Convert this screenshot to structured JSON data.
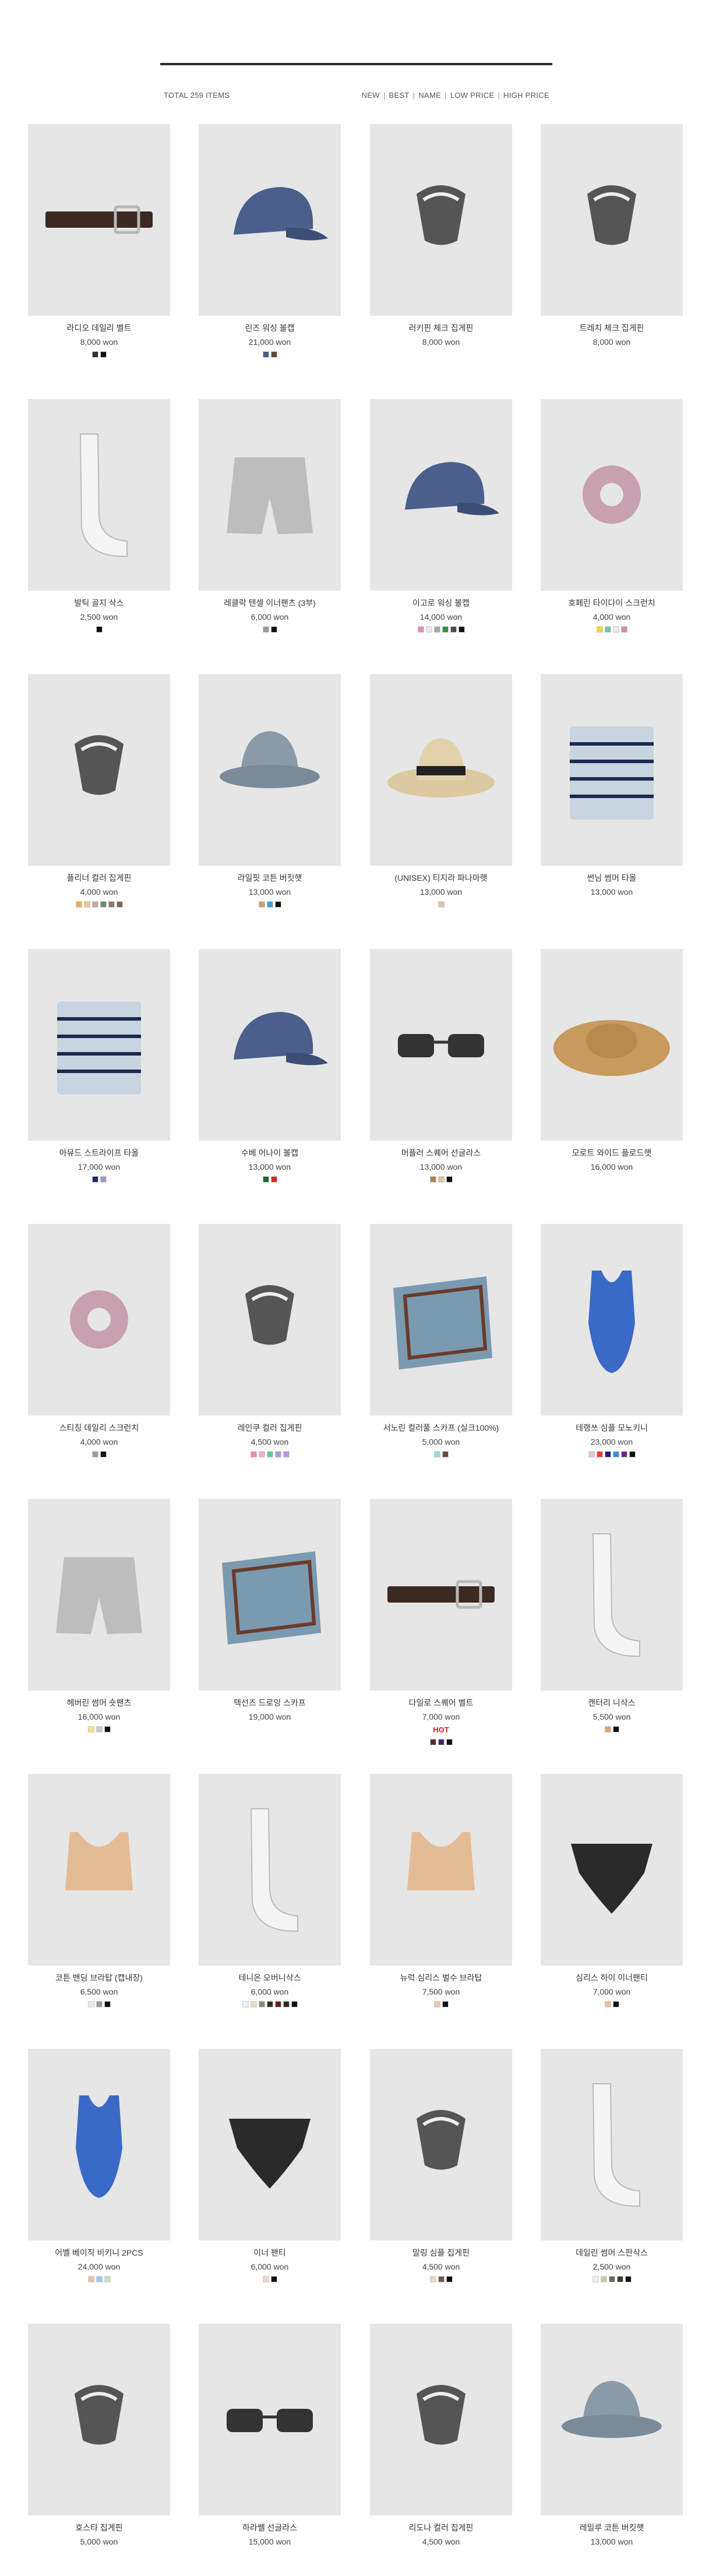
{
  "header": {
    "total_items": "TOTAL 259 ITEMS",
    "sort_options": [
      "NEW",
      "BEST",
      "NAME",
      "LOW PRICE",
      "HIGH PRICE"
    ]
  },
  "products": [
    {
      "name": "라디오 데일리 벨트",
      "price": "8,000 won",
      "colors": [
        "#3a2a20",
        "#111111"
      ],
      "icon": "belt-icon"
    },
    {
      "name": "린즈 워싱 볼캡",
      "price": "21,000 won",
      "colors": [
        "#4a5a80",
        "#5a4a38"
      ],
      "icon": "cap-icon"
    },
    {
      "name": "러키핀 체크 집게핀",
      "price": "8,000 won",
      "colors": [],
      "icon": "hair-claw-icon"
    },
    {
      "name": "트레치 체크 집게핀",
      "price": "8,000 won",
      "colors": [],
      "icon": "hair-claw-icon"
    },
    {
      "name": "발틱 골지 삭스",
      "price": "2,500 won",
      "colors": [
        "#111111"
      ],
      "icon": "socks-icon"
    },
    {
      "name": "레클락 텐셀 이너팬츠 (3부)",
      "price": "6,000 won",
      "colors": [
        "#9a9a9a",
        "#111111"
      ],
      "icon": "shorts-icon"
    },
    {
      "name": "이고로 워싱 볼캡",
      "price": "14,000 won",
      "colors": [
        "#e58ac0",
        "#e8e8e8",
        "#a8a8a8",
        "#2f8f3a",
        "#4a4a4a",
        "#111111"
      ],
      "icon": "cap-icon"
    },
    {
      "name": "호페린 타이다이 스크런치",
      "price": "4,000 won",
      "colors": [
        "#f2d63a",
        "#6cc6b0",
        "#e9e9e9",
        "#d88aa8"
      ],
      "icon": "scrunchie-icon"
    },
    {
      "name": "플리너 컬러 집게핀",
      "price": "4,000 won",
      "colors": [
        "#f0a860",
        "#e8c890",
        "#d4a0a0",
        "#6a8a6a",
        "#8a7a6a",
        "#7a6a5a"
      ],
      "icon": "hair-claw-icon"
    },
    {
      "name": "라일핏 코튼 버킷햇",
      "price": "13,000 won",
      "colors": [
        "#d4a060",
        "#3aa0e0",
        "#111111"
      ],
      "icon": "bucket-hat-icon"
    },
    {
      "name": "(UNISEX) 티지라 파나마햇",
      "price": "13,000 won",
      "colors": [
        "#d8c8a0"
      ],
      "icon": "panama-hat-icon"
    },
    {
      "name": "썬님 썸머 타올",
      "price": "13,000 won",
      "colors": [],
      "icon": "towel-icon"
    },
    {
      "name": "아뮤드 스트라이프 타올",
      "price": "17,000 won",
      "colors": [
        "#1a2a6a",
        "#9a9ac8"
      ],
      "icon": "towel-icon"
    },
    {
      "name": "수베 어나이 볼캡",
      "price": "13,000 won",
      "colors": [
        "#1a6a2a",
        "#c82a2a"
      ],
      "icon": "cap-icon"
    },
    {
      "name": "머플러 스퀘어 선글라스",
      "price": "13,000 won",
      "colors": [
        "#b08050",
        "#d8c0a0",
        "#111111"
      ],
      "icon": "sunglasses-icon"
    },
    {
      "name": "모로트 와이드 플로드햇",
      "price": "16,000 won",
      "colors": [],
      "icon": "straw-hat-icon"
    },
    {
      "name": "스티칭 데일리 스크런치",
      "price": "4,000 won",
      "colors": [
        "#8aa890",
        "#111111"
      ],
      "icon": "scrunchie-icon"
    },
    {
      "name": "레인쿠 컬러 집게핀",
      "price": "4,500 won",
      "colors": [
        "#f08aa0",
        "#f4b0c8",
        "#6ac88a",
        "#a0a0e0",
        "#c88ae8"
      ],
      "icon": "hair-claw-icon"
    },
    {
      "name": "서노린 컬러풀 스카프 (실크100%)",
      "price": "5,000 won",
      "colors": [
        "#9adfd0",
        "#6a4a3a"
      ],
      "icon": "scarf-icon"
    },
    {
      "name": "테랭쓰 심플 모노키니",
      "price": "23,000 won",
      "colors": [
        "#f0c0c0",
        "#e83a3a",
        "#1a1a8a",
        "#3a8ae0",
        "#6a2a8a",
        "#111111"
      ],
      "icon": "swimsuit-icon"
    },
    {
      "name": "헤버린 썸머 숏팬츠",
      "price": "16,000 won",
      "colors": [
        "#f0e48a",
        "#c8c8c8",
        "#111111"
      ],
      "icon": "shorts-icon"
    },
    {
      "name": "텍선즈 드로잉 스카프",
      "price": "19,000 won",
      "colors": [],
      "icon": "scarf-icon"
    },
    {
      "name": "다일로 스퀘어 벨트",
      "price": "7,000 won",
      "badge": "HOT",
      "colors": [
        "#5a2a2a",
        "#3a2a6a",
        "#111111"
      ],
      "icon": "belt-icon"
    },
    {
      "name": "캔터리 니삭스",
      "price": "5,500 won",
      "colors": [
        "#d4a870",
        "#111111"
      ],
      "icon": "socks-icon"
    },
    {
      "name": "코튼 밴딩 브라탑 (캡내장)",
      "price": "6,500 won",
      "colors": [
        "#e8e8e8",
        "#9a9a9a",
        "#111111"
      ],
      "icon": "bra-top-icon"
    },
    {
      "name": "테니온 오버니삭스",
      "price": "6,000 won",
      "colors": [
        "#f0f0f0",
        "#e8d8c0",
        "#8a8a7a",
        "#3a2a2a",
        "#6a1a1a",
        "#2a2a2a",
        "#111111"
      ],
      "icon": "socks-icon"
    },
    {
      "name": "뉴럭 심리스 벌수 브라탑",
      "price": "7,500 won",
      "colors": [
        "#f0c8a0",
        "#111111"
      ],
      "icon": "bra-top-icon"
    },
    {
      "name": "심리스 하이 이너팬티",
      "price": "7,000 won",
      "colors": [
        "#e8c0a0",
        "#111111"
      ],
      "icon": "underwear-icon"
    },
    {
      "name": "어벨 베이직 비키니 2PCS",
      "price": "24,000 won",
      "colors": [
        "#f0c0a0",
        "#a0c8f0",
        "#c8e0c0"
      ],
      "icon": "swimsuit-icon"
    },
    {
      "name": "이너 팬티",
      "price": "6,000 won",
      "colors": [
        "#f0d8c8",
        "#111111"
      ],
      "icon": "underwear-icon"
    },
    {
      "name": "말링 심플 집게핀",
      "price": "4,500 won",
      "colors": [
        "#e8d8c0",
        "#6a5a4a",
        "#111111"
      ],
      "icon": "hair-claw-icon"
    },
    {
      "name": "데일린 썸머 스판삭스",
      "price": "2,500 won",
      "colors": [
        "#f0f0f0",
        "#c8c8b0",
        "#6a6a5a",
        "#3a3a3a",
        "#111111"
      ],
      "icon": "socks-icon"
    },
    {
      "name": "호스타 집게핀",
      "price": "5,000 won",
      "colors": [],
      "icon": "hair-claw-icon"
    },
    {
      "name": "하라쎌 선글라스",
      "price": "15,000 won",
      "colors": [],
      "icon": "sunglasses-icon"
    },
    {
      "name": "리도나 컬러 집게핀",
      "price": "4,500 won",
      "colors": [],
      "icon": "hair-claw-icon"
    },
    {
      "name": "레밀루 코튼 버킷햇",
      "price": "13,000 won",
      "colors": [],
      "icon": "bucket-hat-icon"
    }
  ]
}
